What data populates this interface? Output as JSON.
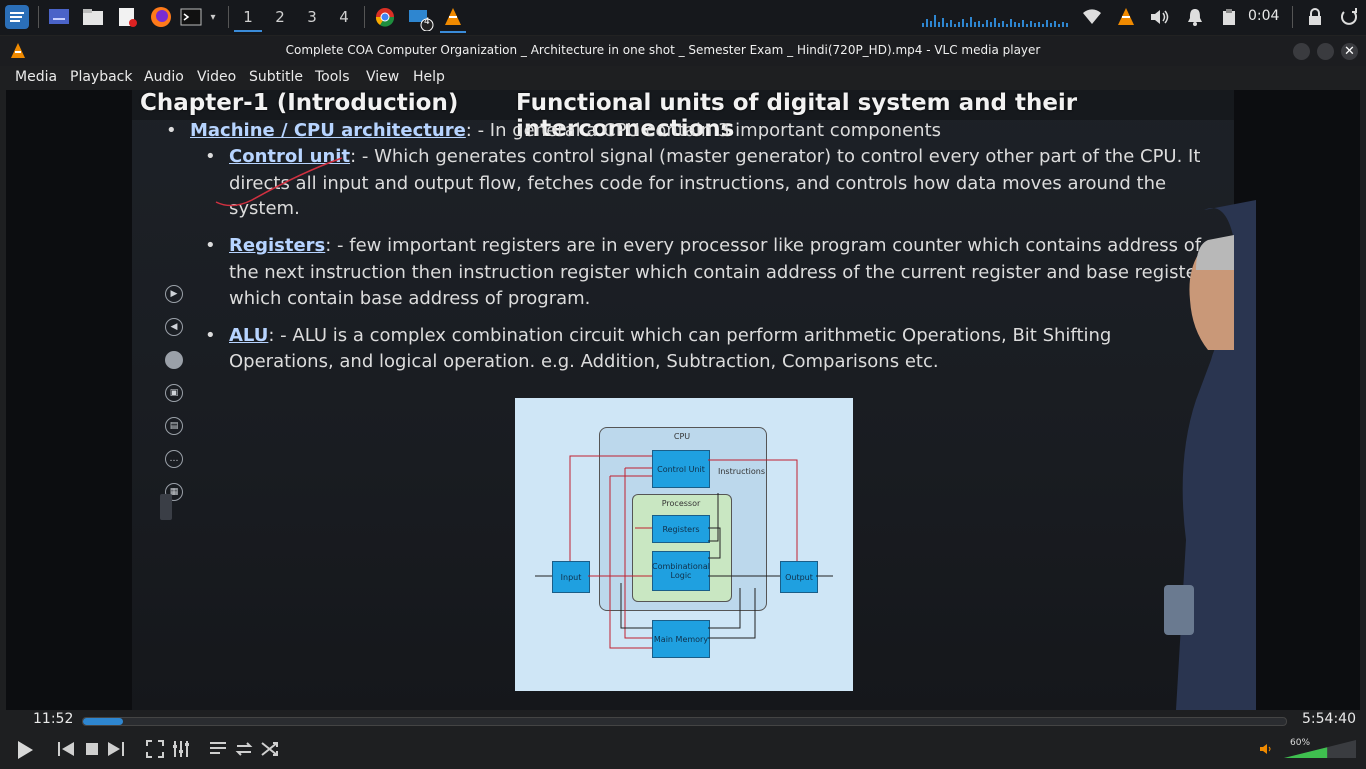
{
  "taskbar": {
    "workspaces": [
      "1",
      "2",
      "3",
      "4"
    ],
    "badge": "4",
    "clock": "0:04"
  },
  "window": {
    "title": "Complete COA Computer Organization _ Architecture in one shot _ Semester Exam _ Hindi(720P_HD).mp4 - VLC media player"
  },
  "menu": {
    "items": [
      {
        "label": "Media"
      },
      {
        "label": "Playback"
      },
      {
        "label": "Audio"
      },
      {
        "label": "Video"
      },
      {
        "label": "Subtitle"
      },
      {
        "label": "Tools"
      },
      {
        "label": "View"
      },
      {
        "label": "Help"
      }
    ]
  },
  "slide": {
    "chapter": "Chapter-1 (Introduction)",
    "heading": "Functional units of digital system and their interconnections",
    "b1_kw": "Machine / CPU architecture",
    "b1_text": ": - In general a CPU contain 3 important components",
    "b2_kw": "Control unit",
    "b2_l1": ": - Which generates control signal (master generator) to control every other part of the CPU. It",
    "b2_l2": "directs all input and output flow, fetches code for instructions, and controls how data moves around the",
    "b2_l3": "system.",
    "b3_kw": "Registers",
    "b3_l1": ": - few important registers are in every processor like program counter which contains address of",
    "b3_l2": "the next instruction then instruction register which contain address of the current register and base register",
    "b3_l3": "which contain base address of program.",
    "b4_kw": "ALU",
    "b4_l1": ": - ALU is a complex combination circuit which can perform arithmetic Operations, Bit Shifting",
    "b4_l2": "Operations, and logical operation. e.g. Addition, Subtraction, Comparisons etc."
  },
  "diagram": {
    "cpu": "CPU",
    "control_unit": "Control Unit",
    "instructions": "Instructions",
    "processor": "Processor",
    "registers": "Registers",
    "combinational_logic": "Combinational Logic",
    "input": "Input",
    "output": "Output",
    "main_memory": "Main Memory"
  },
  "player": {
    "time_current": "11:52",
    "time_total": "5:54:40",
    "progress": 0.0334,
    "volume": "60%",
    "volume_level": 0.6
  },
  "colors": {
    "accent": "#2e86d0",
    "vlc_orange": "#f08a00"
  }
}
